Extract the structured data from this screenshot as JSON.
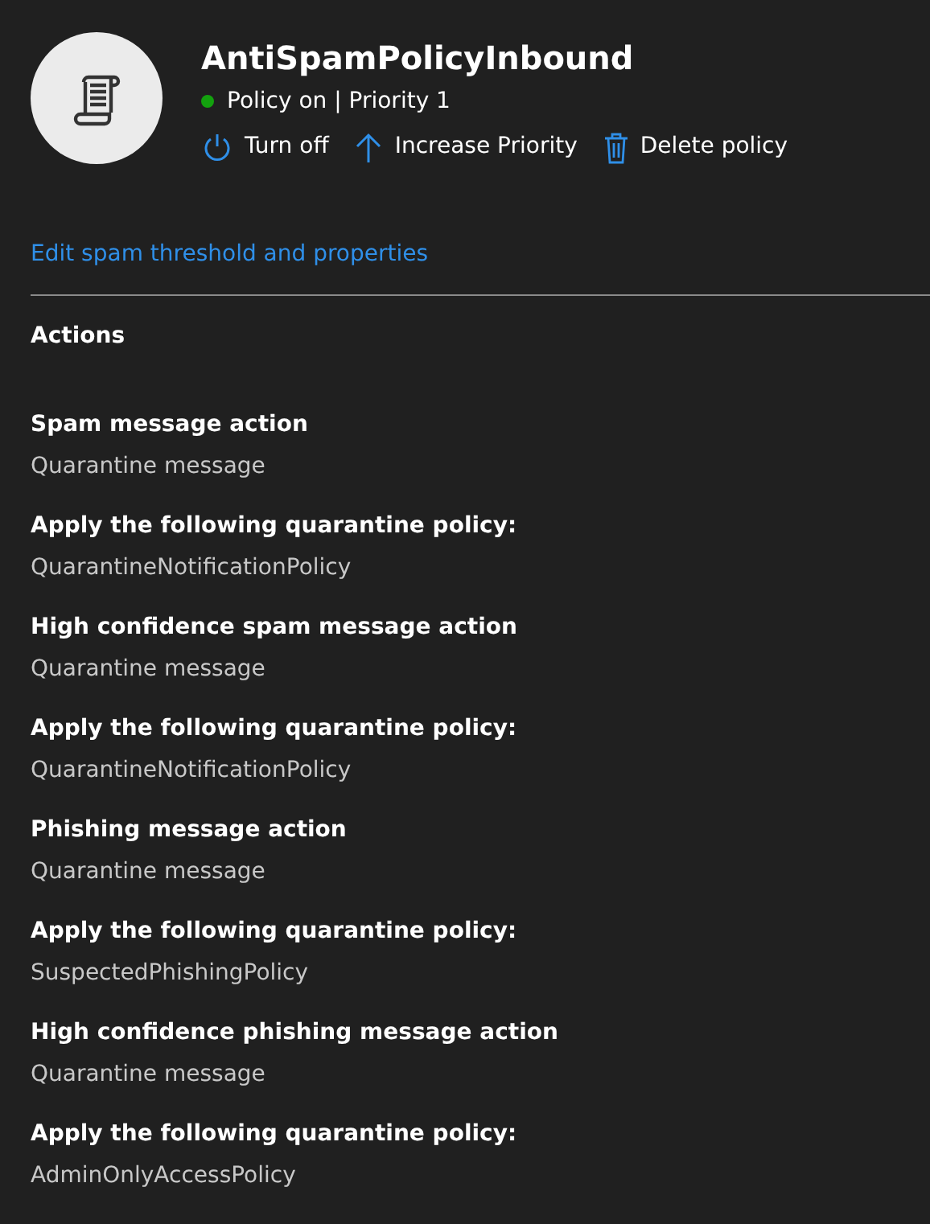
{
  "header": {
    "title": "AntiSpamPolicyInbound",
    "status_on": true,
    "status_text": "Policy on | Priority 1",
    "actions": [
      {
        "kind": "power",
        "label": "Turn off"
      },
      {
        "kind": "arrow-up",
        "label": "Increase Priority"
      },
      {
        "kind": "trash",
        "label": "Delete policy"
      }
    ]
  },
  "edit_link": "Edit spam threshold and properties",
  "section": {
    "title": "Actions",
    "fields": [
      {
        "label": "Spam message action",
        "value": "Quarantine message"
      },
      {
        "label": "Apply the following quarantine policy:",
        "value": "QuarantineNotificationPolicy"
      },
      {
        "label": "High confidence spam message action",
        "value": "Quarantine message"
      },
      {
        "label": "Apply the following quarantine policy:",
        "value": "QuarantineNotificationPolicy"
      },
      {
        "label": "Phishing message action",
        "value": "Quarantine message"
      },
      {
        "label": "Apply the following quarantine policy:",
        "value": "SuspectedPhishingPolicy"
      },
      {
        "label": "High confidence phishing message action",
        "value": "Quarantine message"
      },
      {
        "label": "Apply the following quarantine policy:",
        "value": "AdminOnlyAccessPolicy"
      }
    ]
  }
}
